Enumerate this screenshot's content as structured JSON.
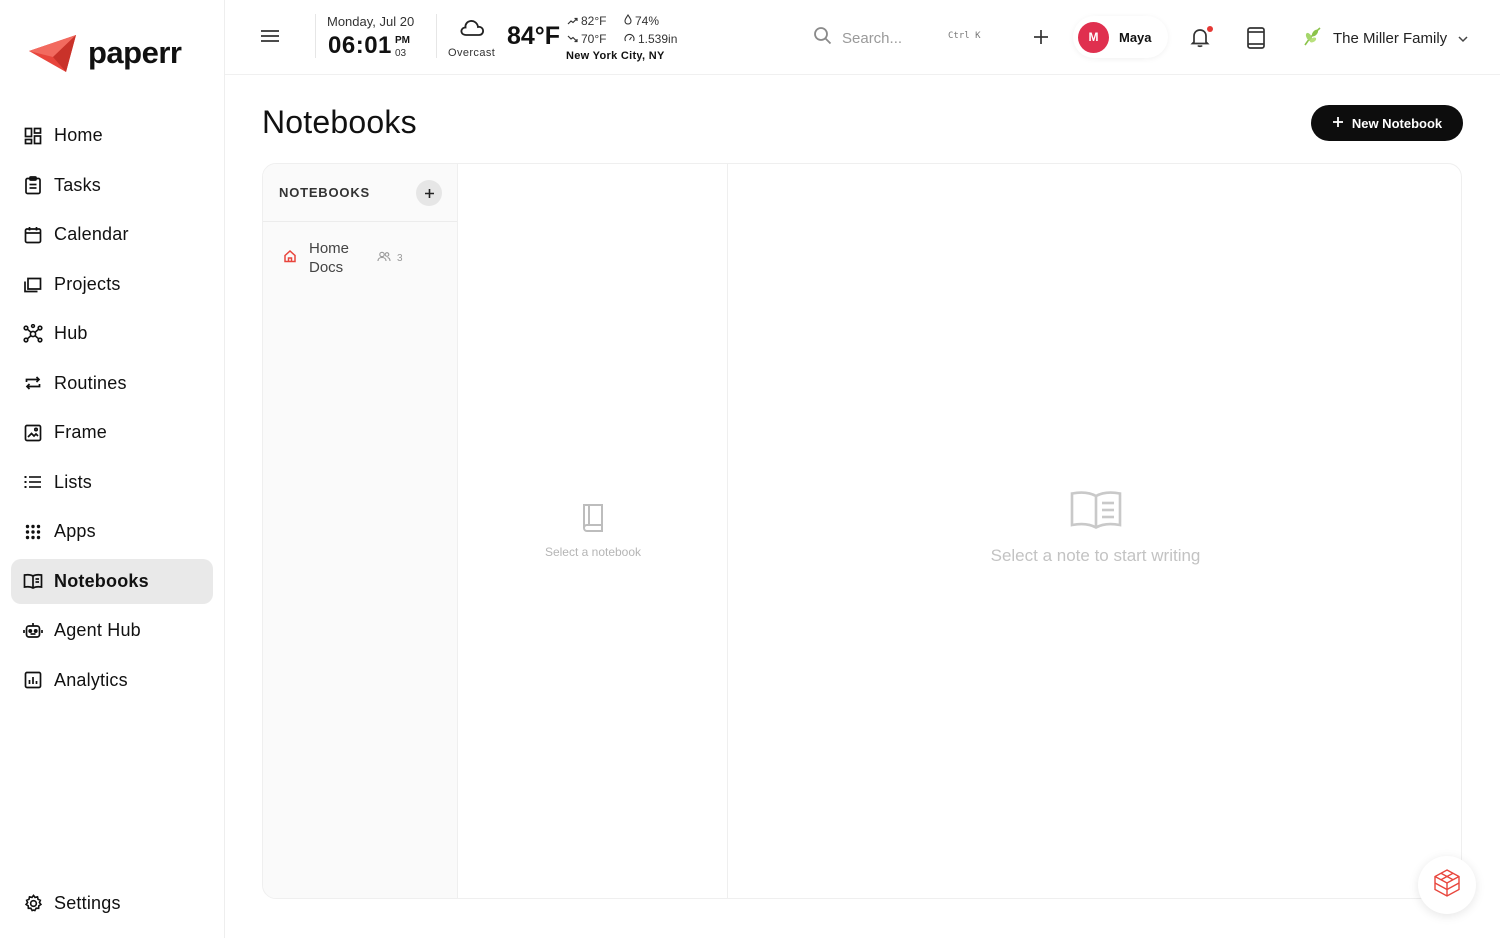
{
  "app": {
    "name": "paperr",
    "brand_color": "#e8453c"
  },
  "sidebar": {
    "items": [
      {
        "label": "Home",
        "icon": "dashboard-icon"
      },
      {
        "label": "Tasks",
        "icon": "clipboard-icon"
      },
      {
        "label": "Calendar",
        "icon": "calendar-icon"
      },
      {
        "label": "Projects",
        "icon": "folders-icon"
      },
      {
        "label": "Hub",
        "icon": "hub-icon"
      },
      {
        "label": "Routines",
        "icon": "repeat-icon"
      },
      {
        "label": "Frame",
        "icon": "frame-icon"
      },
      {
        "label": "Lists",
        "icon": "list-icon"
      },
      {
        "label": "Apps",
        "icon": "grid-icon"
      },
      {
        "label": "Notebooks",
        "icon": "open-book-icon",
        "active": true
      },
      {
        "label": "Agent Hub",
        "icon": "robot-icon"
      },
      {
        "label": "Analytics",
        "icon": "chart-icon"
      }
    ],
    "settings_label": "Settings"
  },
  "topbar": {
    "date": "Monday, Jul 20",
    "time": "06:01",
    "ampm": "PM",
    "seconds": "03",
    "weather": {
      "condition": "Overcast",
      "temp": "84°F",
      "high": "82°F",
      "low": "70°F",
      "humidity": "74%",
      "pressure": "1.539in",
      "location": "New York City, NY"
    },
    "search": {
      "placeholder": "Search...",
      "shortcut": "Ctrl K"
    },
    "user": {
      "initial": "M",
      "name": "Maya",
      "avatar_color": "#e0304f"
    },
    "notification_dot_color": "#e53935",
    "family": "The Miller Family"
  },
  "main": {
    "title": "Notebooks",
    "new_button_label": "New Notebook",
    "notebooks_header": "NOTEBOOKS",
    "notebooks": [
      {
        "name": "Home Docs",
        "members": "3",
        "icon": "home-icon"
      }
    ],
    "empty_notebook_text": "Select a notebook",
    "empty_note_text": "Select a note to start writing"
  }
}
